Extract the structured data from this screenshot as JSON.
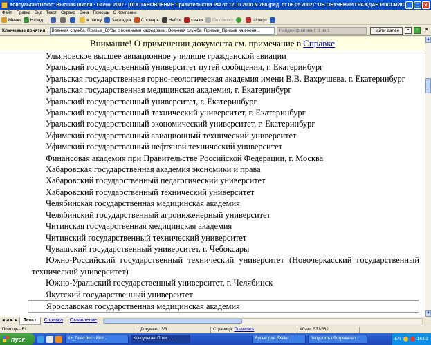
{
  "window": {
    "title": "КонсультантПлюс: Высшая школа · Осень 2007 · [ПОСТАНОВЛЕНИЕ Правительства РФ от 12.10.2000 N 768 (ред. от 08.05.2002) \"ОБ ОБУЧЕНИИ ГРАЖДАН РОССИЙСКОЙ ФЕДЕРАЦИИ]"
  },
  "menu": [
    "Файл",
    "Правка",
    "Вид",
    "Текст",
    "Сервис",
    "Окна",
    "Помощь",
    "О Компании"
  ],
  "toolbar": {
    "menu_label": "Меню",
    "back_label": "Назад",
    "folder_label": "в папку",
    "bookmark_label": "Закладка",
    "dictionary_label": "Словарь",
    "find_label": "Найти",
    "links_label": "связи",
    "list_label": "По списку",
    "font_label": "Шрифт"
  },
  "search": {
    "label": "Ключевые понятия:",
    "value": "Военная служба. Призыв_ВУЗы с военными кафедрами. Военная служба. Призыв_Призыв на военн...",
    "found_text": "Найден фрагмент: 1 из 1",
    "next_label": "Найти далее"
  },
  "notice": {
    "text": "Внимание! О применении документа см. примечание в",
    "link": "Справке"
  },
  "document_lines": [
    "Ульяновское высшее авиационное училище гражданской авиации",
    "Уральский государственный университет путей сообщения, г. Екатеринбург",
    "Уральская государственная горно-геологическая академия имени В.В. Вахрушева, г. Екатеринбург",
    "Уральская государственная медицинская академия, г. Екатеринбург",
    "Уральский государственный университет, г. Екатеринбург",
    "Уральский государственный технический университет, г. Екатеринбург",
    "Уральский государственный экономический университет, г. Екатеринбург",
    "Уфимский государственный авиационный технический университет",
    "Уфимский государственный нефтяной технический университет",
    "Финансовая академия при Правительстве Российской Федерации, г. Москва",
    "Хабаровская государственная академия экономики и права",
    "Хабаровский государственный педагогический университет",
    "Хабаровский государственный технический университет",
    "Челябинская государственная медицинская академия",
    "Челябинский государственный агроинженерный университет",
    "Читинская государственная медицинская академия",
    "Читинский государственный технический университет",
    "Чувашский государственный университет, г. Чебоксары",
    "Южно-Российский государственный технический университет (Новочеркасский государственный технический университет)",
    "Южно-Уральский государственный университет, г. Челябинск",
    "Якутский государственный университет",
    "Ярославская государственная медицинская академия"
  ],
  "tabs": [
    "Текст",
    "Справка",
    "Оглавление"
  ],
  "status": {
    "help": "Помощь - F1",
    "document": "Документ: 3/3",
    "page_label": "Страница:",
    "page_value": "Посчитать",
    "paragraph": "Абзац: 571/582"
  },
  "taskbar": {
    "start": "пуск",
    "tasks": [
      "К+_Пояс.doc - Micr...",
      "КонсультантПлюс ...",
      "Ярлык для EXeler",
      "Запустить обозревател..."
    ],
    "lang": "EN",
    "clock": "16:03"
  },
  "colors": {
    "title_blue": "#0a5fe0",
    "link_blue": "#0000cc",
    "notice_bg": "#ffffe1",
    "start_green": "#3fa43a"
  }
}
